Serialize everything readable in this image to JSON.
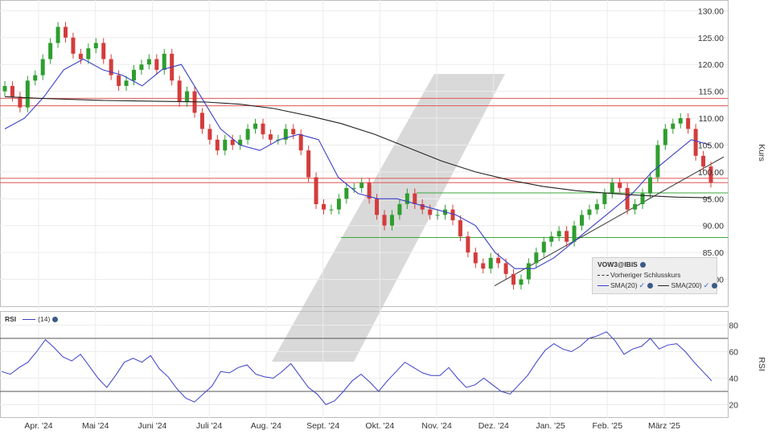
{
  "chart_data": [
    {
      "type": "candlestick",
      "symbol": "VOW3@IBIS",
      "ylabel": "Kurs",
      "ylim": [
        75,
        132
      ],
      "y_ticks": [
        "80.00",
        "85.00",
        "90.00",
        "95.00",
        "100.00",
        "105.00",
        "110.00",
        "115.00",
        "120.00",
        "125.00",
        "130.00"
      ],
      "x_ticks": [
        "Apr. '24",
        "Mai '24",
        "Juni '24",
        "Juli '24",
        "Aug. '24",
        "Sept. '24",
        "Okt. '24",
        "Nov. '24",
        "Dez. '24",
        "Jan. '25",
        "Feb. '25",
        "März '25"
      ],
      "legend": {
        "title": "VOW3@IBIS",
        "entries": [
          "Vorheriger Schlusskurs",
          "SMA(20)",
          "SMA(200)"
        ]
      },
      "series": [
        {
          "name": "SMA(20)",
          "color": "#3a3fc9",
          "values": [
            108,
            110,
            114,
            119,
            121,
            119,
            118,
            116,
            119,
            120,
            114,
            108,
            105,
            104,
            106,
            107,
            106,
            99,
            96,
            95,
            95,
            94,
            93,
            92,
            90,
            85,
            82,
            82,
            84,
            87,
            90,
            93,
            96,
            100,
            103,
            106,
            105
          ]
        },
        {
          "name": "SMA(200)",
          "color": "#222222",
          "values": [
            114,
            113.7,
            113.5,
            113.3,
            113.2,
            113.1,
            113,
            112.6,
            111.8,
            110.5,
            109,
            107,
            104.5,
            102,
            100,
            98.5,
            97.3,
            96.5,
            96,
            95.6,
            95.3,
            95.2
          ]
        }
      ],
      "horizontal_lines": [
        {
          "value": 113.7,
          "color": "#e05555"
        },
        {
          "value": 112.3,
          "color": "#e05555"
        },
        {
          "value": 98.8,
          "color": "#e05555"
        },
        {
          "value": 98.0,
          "color": "#e05555"
        },
        {
          "value": 96.1,
          "color": "#3aa83a"
        },
        {
          "value": 87.8,
          "color": "#3aa83a"
        }
      ],
      "trendline": {
        "from": 78.8,
        "to": 102.8
      },
      "closes": [
        116,
        114,
        112,
        117,
        118,
        121,
        124,
        127,
        125,
        122,
        121,
        123,
        124,
        121,
        118,
        116,
        117,
        119,
        120,
        121,
        119,
        122,
        117,
        113,
        115,
        111,
        108,
        106,
        104,
        106,
        105,
        106,
        108,
        109,
        107,
        106,
        106,
        108,
        107,
        104,
        99,
        94,
        93,
        93,
        95,
        97,
        97,
        98,
        95,
        92,
        90,
        92,
        94,
        96,
        94,
        93,
        92,
        92,
        93,
        91,
        88,
        85,
        83,
        82,
        84,
        83,
        81,
        79,
        80,
        83,
        85,
        87,
        88,
        89,
        87,
        90,
        92,
        93,
        94,
        96,
        98,
        97,
        93,
        94,
        96,
        99,
        105,
        108,
        109,
        110,
        108,
        103,
        101,
        98
      ]
    },
    {
      "type": "line",
      "name": "RSI",
      "period": "(14)",
      "ylabel": "RSI",
      "ylim": [
        10,
        90
      ],
      "y_ticks": [
        "20",
        "40",
        "60",
        "80"
      ],
      "reference_lines": [
        70,
        30
      ],
      "values": [
        45,
        43,
        48,
        52,
        60,
        69,
        63,
        56,
        53,
        58,
        49,
        40,
        33,
        42,
        52,
        55,
        52,
        57,
        47,
        41,
        32,
        25,
        22,
        28,
        34,
        45,
        44,
        48,
        50,
        43,
        41,
        40,
        45,
        51,
        42,
        33,
        28,
        20,
        23,
        30,
        38,
        43,
        37,
        30,
        38,
        45,
        52,
        48,
        44,
        42,
        42,
        48,
        40,
        33,
        35,
        40,
        35,
        30,
        28,
        35,
        42,
        52,
        61,
        66,
        62,
        60,
        64,
        70,
        72,
        75,
        68,
        58,
        62,
        64,
        70,
        62,
        65,
        66,
        60,
        52,
        45,
        38
      ]
    }
  ]
}
